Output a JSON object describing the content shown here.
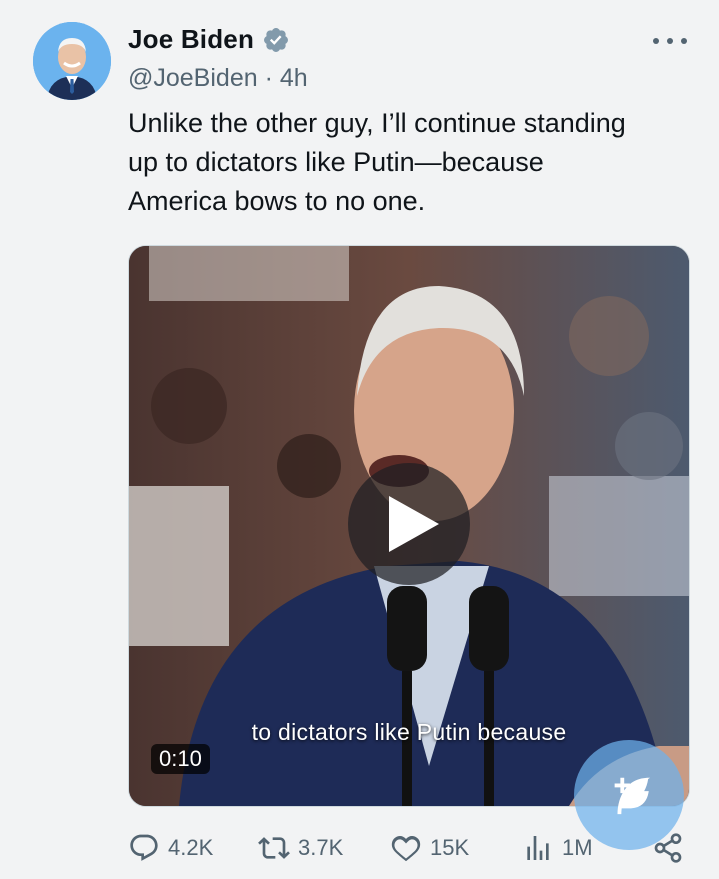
{
  "author": {
    "name": "Joe Biden",
    "handle": "@JoeBiden",
    "time": "4h",
    "handle_time": "@JoeBiden · 4h"
  },
  "tweet": {
    "lines": [
      "Unlike the other guy, I’ll continue standing",
      "up to dictators like Putin—because",
      "America bows to no one."
    ]
  },
  "video": {
    "caption": "to dictators like Putin because",
    "duration": "0:10"
  },
  "actions": {
    "replies": "4.2K",
    "reposts": "3.7K",
    "likes": "15K",
    "views": "1M"
  },
  "icons": {
    "verified": "verified-badge-icon",
    "more": "more-options-icon",
    "reply": "reply-icon",
    "repost": "repost-icon",
    "like": "heart-icon",
    "views": "views-chart-icon",
    "share": "share-icon",
    "play": "play-icon",
    "compose": "compose-icon"
  },
  "colors": {
    "background": "#f2f3f4",
    "text": "#0f1419",
    "muted": "#536471",
    "accent": "#1d9bf0",
    "verified_badge": "#829aab"
  }
}
